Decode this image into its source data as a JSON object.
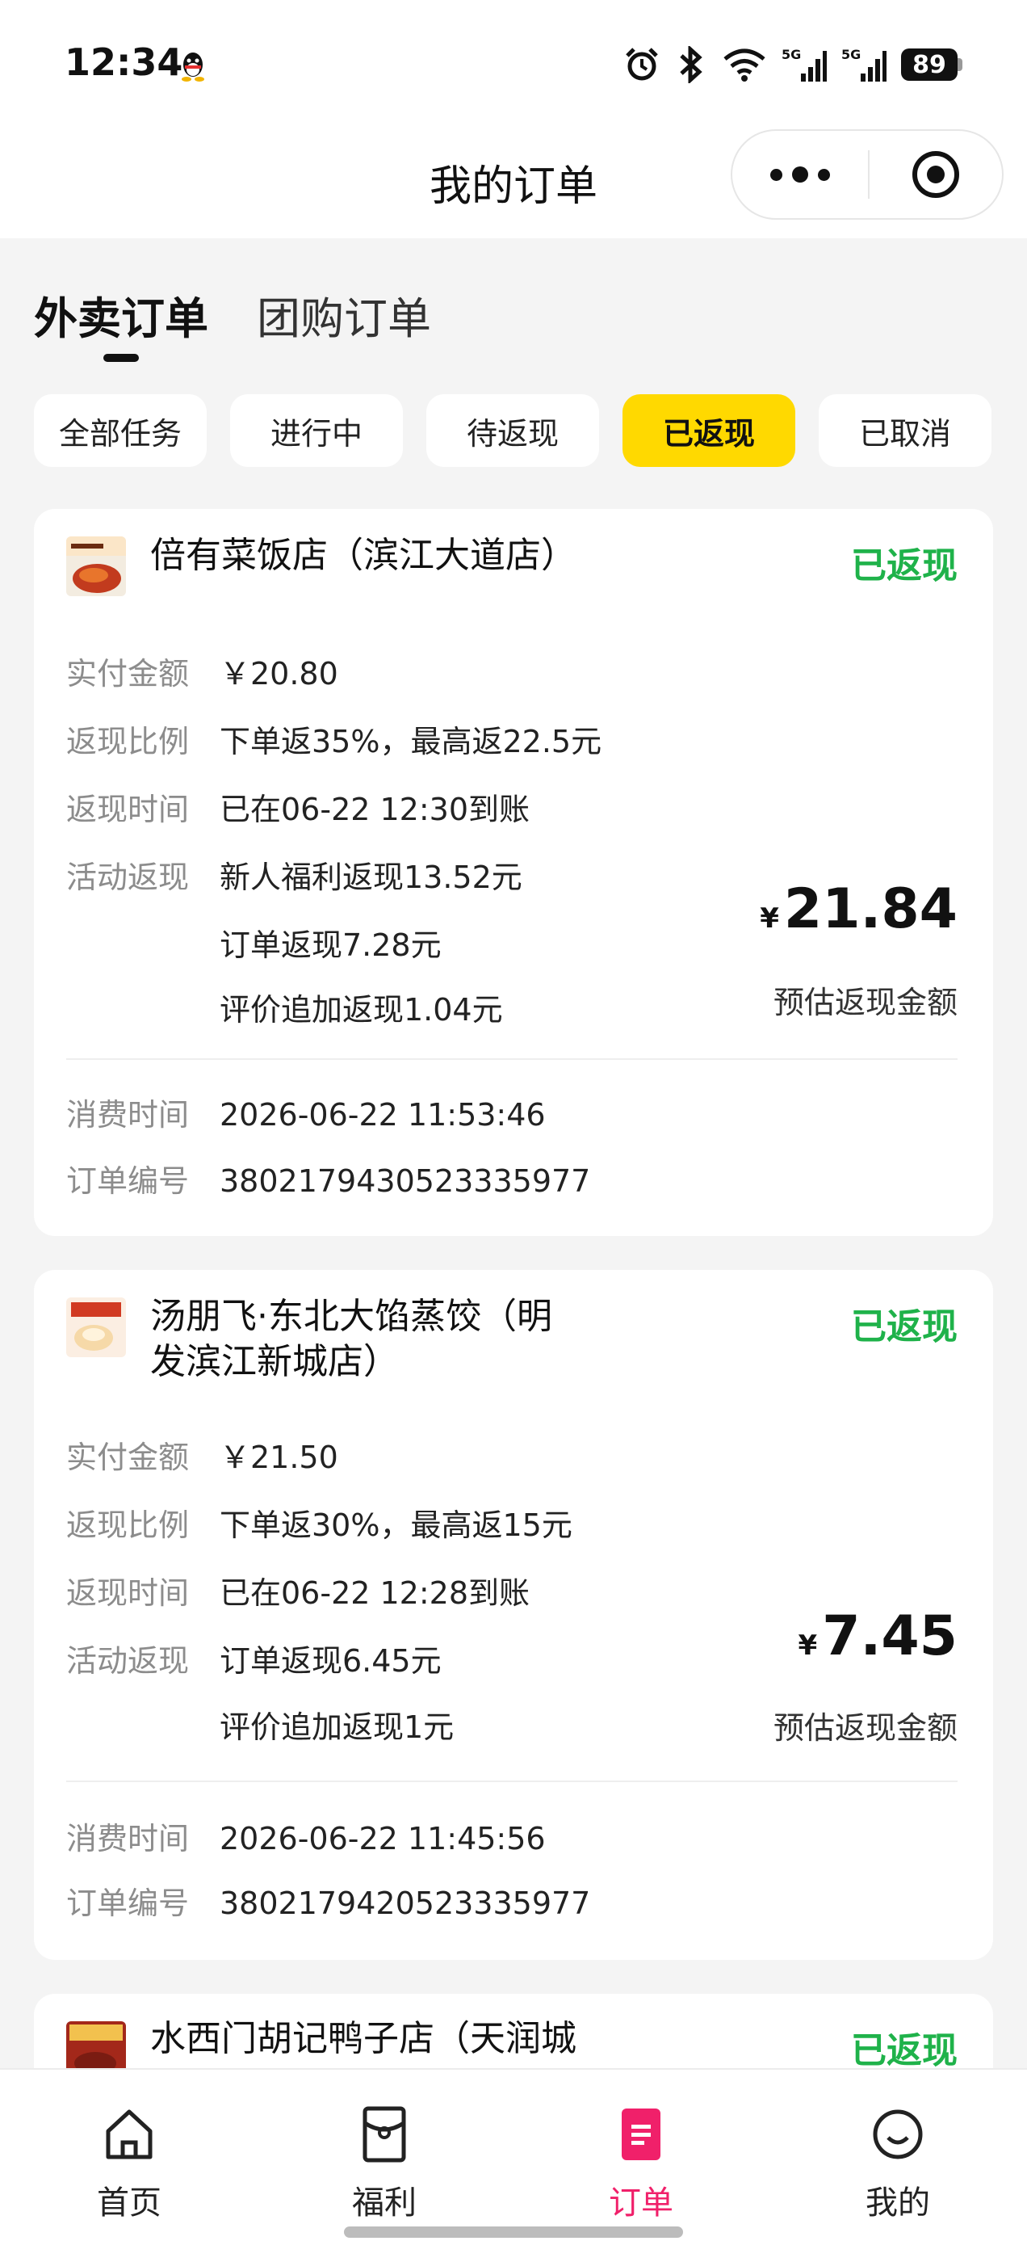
{
  "status_bar": {
    "time": "12:34",
    "battery": "89"
  },
  "nav": {
    "title": "我的订单"
  },
  "main_tabs": [
    "外卖订单",
    "团购订单"
  ],
  "filters": [
    "全部任务",
    "进行中",
    "待返现",
    "已返现",
    "已取消"
  ],
  "labels": {
    "paid": "实付金额",
    "ratio": "返现比例",
    "cashback_time": "返现时间",
    "activity": "活动返现",
    "consume_time": "消费时间",
    "order_no": "订单编号",
    "estimate": "预估返现金额",
    "yuan_symbol": "¥"
  },
  "orders": [
    {
      "shop": "倍有菜饭店（滨江大道店）",
      "status": "已返现",
      "paid": "￥20.80",
      "ratio": "下单返35%，最高返22.5元",
      "cashback_time": "已在06-22 12:30到账",
      "activity": [
        "新人福利返现13.52元",
        "订单返现7.28元",
        "评价追加返现1.04元"
      ],
      "amount": "21.84",
      "consume_time": "2026-06-22 11:53:46",
      "order_no": "3802179430523335977"
    },
    {
      "shop_line1": "汤朋飞·东北大馅蒸饺（明",
      "shop_line2": "发滨江新城店）",
      "status": "已返现",
      "paid": "￥21.50",
      "ratio": "下单返30%，最高返15元",
      "cashback_time": "已在06-22 12:28到账",
      "activity": [
        "订单返现6.45元",
        "评价追加返现1元"
      ],
      "amount": "7.45",
      "consume_time": "2026-06-22 11:45:56",
      "order_no": "3802179420523335977"
    },
    {
      "shop": "水西门胡记鸭子店（天润城",
      "status": "已返现"
    }
  ],
  "bottom_nav": [
    "首页",
    "福利",
    "订单",
    "我的"
  ],
  "colors": {
    "accent_yellow": "#ffd900",
    "status_green": "#1fb24a",
    "active_pink": "#f0206a"
  }
}
